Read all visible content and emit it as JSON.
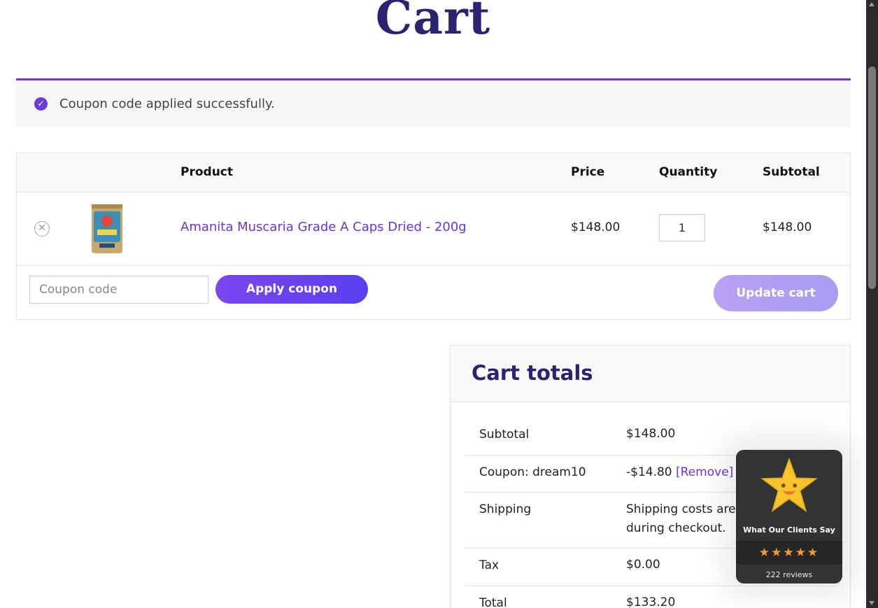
{
  "page": {
    "title": "Cart"
  },
  "notice": {
    "message": "Coupon code applied successfully.",
    "icon": "check-circle-icon",
    "accent": "#6d3bd6"
  },
  "table": {
    "headers": {
      "product": "Product",
      "price": "Price",
      "quantity": "Quantity",
      "subtotal": "Subtotal"
    },
    "rows": [
      {
        "name": "Amanita Muscaria Grade A Caps Dried - 200g",
        "price": "$148.00",
        "quantity": "1",
        "subtotal": "$148.00"
      }
    ]
  },
  "actions": {
    "coupon_placeholder": "Coupon code",
    "apply_label": "Apply coupon",
    "update_label": "Update cart"
  },
  "totals": {
    "title": "Cart totals",
    "subtotal_label": "Subtotal",
    "subtotal_value": "$148.00",
    "coupon_label": "Coupon: dream10",
    "coupon_value": "-$14.80",
    "coupon_remove": "[Remove]",
    "shipping_label": "Shipping",
    "shipping_value_1": "Shipping costs are",
    "shipping_value_2": "during checkout.",
    "tax_label": "Tax",
    "tax_value": "$0.00",
    "total_label": "Total",
    "total_value": "$133.20"
  },
  "review_badge": {
    "title": "What Our Clients Say",
    "stars": "★★★★★",
    "rating": 5,
    "count": "222 reviews"
  },
  "colors": {
    "brand": "#2a2470",
    "accent": "#6a35d9"
  }
}
